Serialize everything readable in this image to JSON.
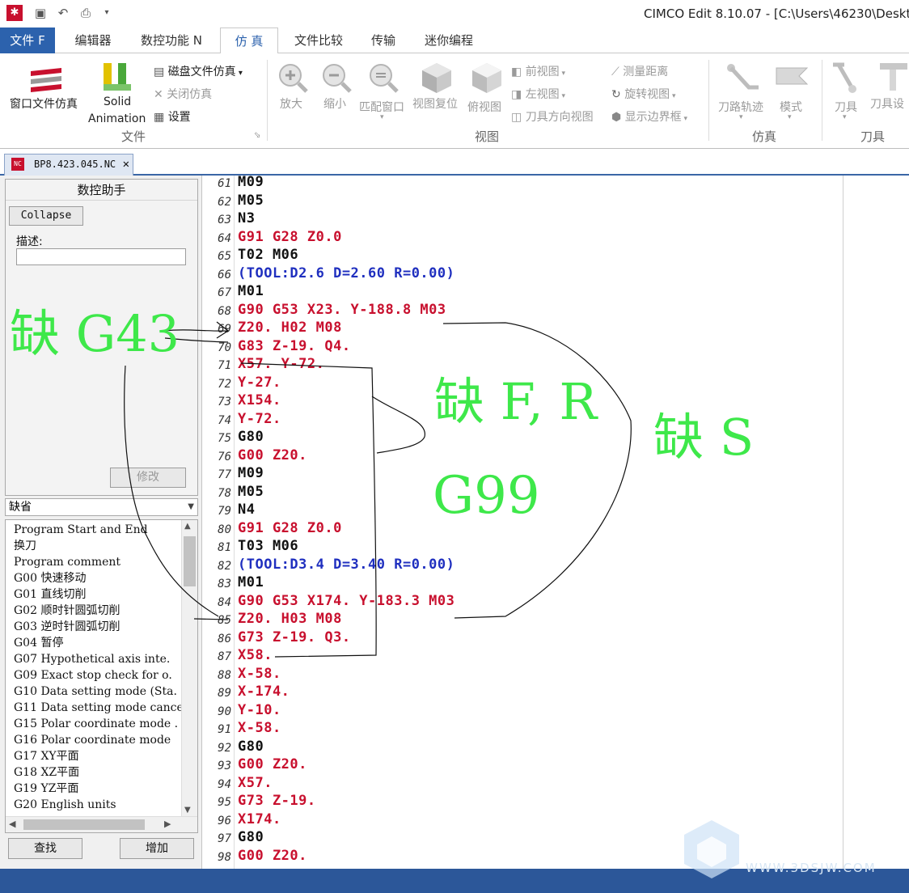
{
  "window": {
    "title": "CIMCO Edit 8.10.07 - [C:\\Users\\46230\\Deskto"
  },
  "ribbon_tabs": [
    "文件 F",
    "编辑器",
    "数控功能 N",
    "仿 真",
    "文件比较",
    "传输",
    "迷你编程"
  ],
  "ribbon": {
    "file_group": {
      "btn_window_sim": "窗口文件仿真",
      "btn_solid_line1": "Solid",
      "btn_solid_line2": "Animation",
      "btn_disk_sim": "磁盘文件仿真",
      "btn_close_sim": "关闭仿真",
      "btn_settings": "设置",
      "label": "文件"
    },
    "view_group": {
      "zoom_in": "放大",
      "zoom_out": "缩小",
      "fit_window": "匹配窗口",
      "view_reset": "视图复位",
      "top_view": "俯视图",
      "front_view": "前视图",
      "left_view": "左视图",
      "tool_dir_view": "刀具方向视图",
      "measure": "测量距离",
      "rotate_view": "旋转视图",
      "show_bounds": "显示边界框",
      "label": "视图"
    },
    "sim_group": {
      "toolpath": "刀路轨迹",
      "mode": "模式",
      "label": "仿真"
    },
    "tool_group": {
      "tool": "刀具",
      "tool_settings": "刀具设",
      "label": "刀具"
    }
  },
  "doc_tab": {
    "label": "BP8.423.045.NC"
  },
  "left_pane": {
    "title": "数控助手",
    "collapse_btn": "Collapse",
    "desc_label": "描述:",
    "modify_btn": "修改",
    "dropdown_value": "缺省",
    "list_items": [
      "Program Start and End",
      "换刀",
      "Program comment",
      "G00 快速移动",
      "G01 直线切削",
      "G02 顺时针圆弧切削",
      "G03 逆时针圆弧切削",
      "G04 暂停",
      "G07 Hypothetical axis inte.",
      "G09 Exact stop check for o.",
      "G10 Data setting mode (Sta.",
      "G11 Data setting mode cance",
      "G15 Polar coordinate mode .",
      "G16 Polar coordinate mode",
      "G17 XY平面",
      "G18 XZ平面",
      "G19 YZ平面",
      "G20 English units"
    ],
    "find_btn": "查找",
    "add_btn": "增加"
  },
  "code_lines": [
    {
      "n": "61",
      "t": "M09",
      "c": "black"
    },
    {
      "n": "62",
      "t": "M05",
      "c": "black"
    },
    {
      "n": "63",
      "t": "N3",
      "c": "black"
    },
    {
      "n": "64",
      "t": "G91 G28 Z0.0",
      "c": "red"
    },
    {
      "n": "65",
      "t": "T02 M06",
      "c": "black"
    },
    {
      "n": "66",
      "t": "(TOOL:D2.6 D=2.60 R=0.00)",
      "c": "blue"
    },
    {
      "n": "67",
      "t": "M01",
      "c": "black"
    },
    {
      "n": "68",
      "t": "G90 G53 X23. Y-188.8 M03",
      "c": "red"
    },
    {
      "n": "69",
      "t": "Z20. H02 M08",
      "c": "red"
    },
    {
      "n": "70",
      "t": "G83 Z-19. Q4.",
      "c": "red"
    },
    {
      "n": "71",
      "t": "X57. Y-72.",
      "c": "red"
    },
    {
      "n": "72",
      "t": "Y-27.",
      "c": "red"
    },
    {
      "n": "73",
      "t": "X154.",
      "c": "red"
    },
    {
      "n": "74",
      "t": "Y-72.",
      "c": "red"
    },
    {
      "n": "75",
      "t": "G80",
      "c": "black"
    },
    {
      "n": "76",
      "t": "G00 Z20.",
      "c": "red"
    },
    {
      "n": "77",
      "t": "M09",
      "c": "black"
    },
    {
      "n": "78",
      "t": "M05",
      "c": "black"
    },
    {
      "n": "79",
      "t": "N4",
      "c": "black"
    },
    {
      "n": "80",
      "t": "G91 G28 Z0.0",
      "c": "red"
    },
    {
      "n": "81",
      "t": "T03 M06",
      "c": "black"
    },
    {
      "n": "82",
      "t": "(TOOL:D3.4 D=3.40 R=0.00)",
      "c": "blue"
    },
    {
      "n": "83",
      "t": "M01",
      "c": "black"
    },
    {
      "n": "84",
      "t": "G90 G53 X174. Y-183.3 M03",
      "c": "red"
    },
    {
      "n": "85",
      "t": "Z20. H03 M08",
      "c": "red"
    },
    {
      "n": "86",
      "t": "G73 Z-19. Q3.",
      "c": "red"
    },
    {
      "n": "87",
      "t": "X58.",
      "c": "red"
    },
    {
      "n": "88",
      "t": "X-58.",
      "c": "red"
    },
    {
      "n": "89",
      "t": "X-174.",
      "c": "red"
    },
    {
      "n": "90",
      "t": "Y-10.",
      "c": "red"
    },
    {
      "n": "91",
      "t": "X-58.",
      "c": "red"
    },
    {
      "n": "92",
      "t": "G80",
      "c": "black"
    },
    {
      "n": "93",
      "t": "G00 Z20.",
      "c": "red"
    },
    {
      "n": "94",
      "t": "X57.",
      "c": "red"
    },
    {
      "n": "95",
      "t": "G73 Z-19.",
      "c": "red"
    },
    {
      "n": "96",
      "t": "X174.",
      "c": "red"
    },
    {
      "n": "97",
      "t": "G80",
      "c": "black"
    },
    {
      "n": "98",
      "t": "G00 Z20.",
      "c": "red"
    }
  ],
  "annotations": {
    "missing_g43": "缺 G43",
    "missing_fr": "缺 F, R",
    "missing_s": "缺 S",
    "g99": "G99"
  },
  "watermark": "WWW.3DSJW.COM",
  "colors": {
    "accent": "#2c62ad",
    "code_red": "#c8102e",
    "code_blue": "#1f2fbf",
    "annotation_green": "#3ee84a"
  }
}
